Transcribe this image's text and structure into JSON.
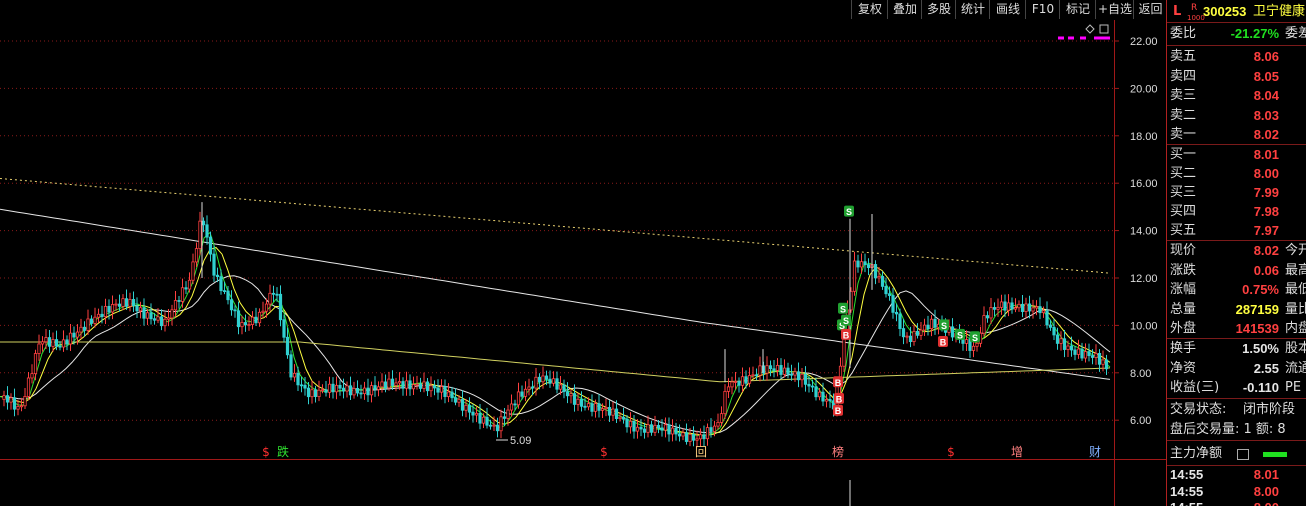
{
  "toolbar": {
    "buttons": [
      "复权",
      "叠加",
      "多股",
      "统计",
      "画线",
      "F10",
      "标记",
      "+自选",
      "返回"
    ]
  },
  "axis": {
    "ticks": [
      "22.00",
      "20.00",
      "18.00",
      "16.00",
      "14.00",
      "12.00",
      "10.00",
      "8.00",
      "6.00"
    ]
  },
  "annotations": {
    "low_label": "5.09",
    "event_markers": [
      {
        "text": "$",
        "color": "#ff3030"
      },
      {
        "text": "跌",
        "color": "#30e030"
      },
      {
        "text": "$",
        "color": "#ff3030"
      },
      {
        "text": "回",
        "color": "#ffd080"
      },
      {
        "text": "榜",
        "color": "#ff8080"
      },
      {
        "text": "$",
        "color": "#ff3030"
      },
      {
        "text": "增",
        "color": "#ff8080"
      },
      {
        "text": "财",
        "color": "#80b0ff"
      }
    ],
    "signals": [
      "S",
      "S",
      "S",
      "B",
      "S",
      "B",
      "B",
      "B",
      "S",
      "S",
      "S",
      "B"
    ]
  },
  "stock": {
    "prefix": "L",
    "badge_top": "R",
    "badge_bottom": "1000",
    "code": "300253",
    "name_visible": "卫宁健康"
  },
  "order_ratio": {
    "label": "委比",
    "value": "-21.27%",
    "cut": "委差"
  },
  "asks": [
    {
      "label": "卖五",
      "price": "8.06"
    },
    {
      "label": "卖四",
      "price": "8.05"
    },
    {
      "label": "卖三",
      "price": "8.04"
    },
    {
      "label": "卖二",
      "price": "8.03"
    },
    {
      "label": "卖一",
      "price": "8.02"
    }
  ],
  "bids": [
    {
      "label": "买一",
      "price": "8.01"
    },
    {
      "label": "买二",
      "price": "8.00"
    },
    {
      "label": "买三",
      "price": "7.99"
    },
    {
      "label": "买四",
      "price": "7.98"
    },
    {
      "label": "买五",
      "price": "7.97"
    }
  ],
  "quote": [
    {
      "label": "现价",
      "value": "8.02",
      "color": "#ff4040",
      "cut": "今开"
    },
    {
      "label": "涨跌",
      "value": "0.06",
      "color": "#ff4040",
      "cut": "最高"
    },
    {
      "label": "涨幅",
      "value": "0.75%",
      "color": "#ff4040",
      "cut": "最低"
    },
    {
      "label": "总量",
      "value": "287159",
      "color": "#ffff40",
      "cut": "量比"
    },
    {
      "label": "外盘",
      "value": "141539",
      "color": "#ff4040",
      "cut": "内盘"
    }
  ],
  "stats": [
    {
      "label": "换手",
      "value": "1.50%",
      "color": "#e6e6e6",
      "cut": "股本"
    },
    {
      "label": "净资",
      "value": "2.55",
      "color": "#e6e6e6",
      "cut": "流通"
    },
    {
      "label": "收益(三)",
      "value": "-0.110",
      "color": "#e6e6e6",
      "cut": "PE"
    }
  ],
  "trade_status": {
    "label": "交易状态:",
    "value": "闭市阶段"
  },
  "after_hours": {
    "text": "盘后交易量: 1  额: 8"
  },
  "main_flow": {
    "label": "主力净额"
  },
  "ticks": [
    {
      "time": "14:55",
      "price": "8.01"
    },
    {
      "time": "14:55",
      "price": "8.00"
    },
    {
      "time": "14:55",
      "price": "8.00"
    }
  ],
  "colors": {
    "up": "#ff4040",
    "down": "#20e020",
    "accent": "#ff00ff",
    "border": "#b02020"
  }
}
